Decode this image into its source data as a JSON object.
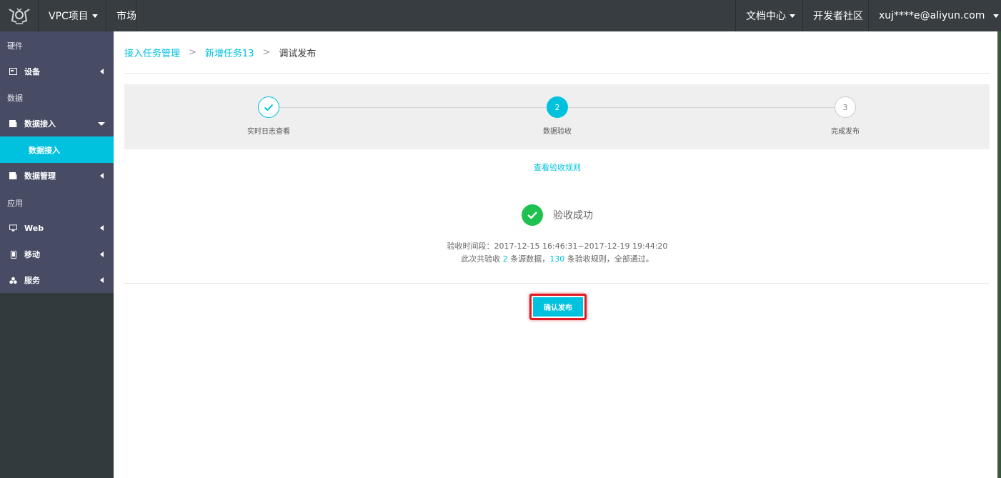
{
  "topbar": {
    "project_label": "VPC项目",
    "market_label": "市场",
    "docs_label": "文档中心",
    "community_label": "开发者社区",
    "user_label": "xuj****e@aliyun.com"
  },
  "sidebar": {
    "sections": {
      "hardware": "硬件",
      "data": "数据",
      "app": "应用"
    },
    "items": {
      "device": "设备",
      "data_access": "数据接入",
      "data_access_sub": "数据接入",
      "data_mgmt": "数据管理",
      "web": "Web",
      "mobile": "移动",
      "service": "服务"
    }
  },
  "breadcrumb": {
    "item1": "接入任务管理",
    "item2": "新增任务13",
    "current": "调试发布",
    "separator": ">"
  },
  "steps": [
    {
      "number": "",
      "label": "实时日志查看",
      "state": "done"
    },
    {
      "number": "2",
      "label": "数据验收",
      "state": "active"
    },
    {
      "number": "3",
      "label": "完成发布",
      "state": "pending"
    }
  ],
  "rules_link": "查看验收规则",
  "result": {
    "title": "验收成功",
    "period_label": "验收时间段：",
    "period_value": "2017-12-15 16:46:31~2017-12-19 19:44:20",
    "summary_prefix": "此次共验收",
    "source_count": "2",
    "summary_mid": "条源数据，",
    "rule_count": "130",
    "summary_suffix": "条验收规则，全部通过。"
  },
  "confirm_button": "确认发布",
  "colors": {
    "accent": "#00c1de",
    "success": "#1ec14f",
    "topbar": "#373d41",
    "sidebar": "#474c64",
    "highlight_border": "#e01b24"
  }
}
